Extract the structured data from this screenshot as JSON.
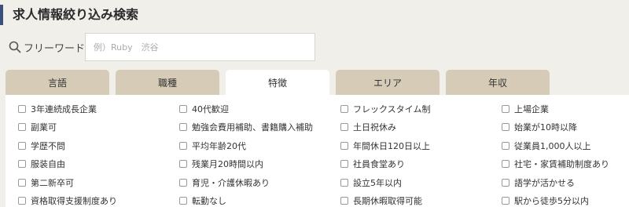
{
  "heading": "求人情報絞り込み検索",
  "search": {
    "label": "フリーワード",
    "placeholder": "例）Ruby　渋谷",
    "value": ""
  },
  "tabs": [
    {
      "label": "言語",
      "active": false
    },
    {
      "label": "職種",
      "active": false
    },
    {
      "label": "特徴",
      "active": true
    },
    {
      "label": "エリア",
      "active": false
    },
    {
      "label": "年収",
      "active": false
    }
  ],
  "options": [
    "3年連続成長企業",
    "40代歓迎",
    "フレックスタイム制",
    "上場企業",
    "副業可",
    "勉強会費用補助、書籍購入補助",
    "土日祝休み",
    "始業が10時以降",
    "学歴不問",
    "平均年齢20代",
    "年間休日120日以上",
    "従業員1,000人以上",
    "服装自由",
    "残業月20時間以内",
    "社員食堂あり",
    "社宅・家賃補助制度あり",
    "第二新卒可",
    "育児・介護休暇あり",
    "設立5年以内",
    "語学が活かせる",
    "資格取得支援制度あり",
    "転勤なし",
    "長期休暇取得可能",
    "駅から徒歩5分以内"
  ],
  "colors": {
    "heading_bar": "#3c4f7a",
    "tab_inactive": "#d6cbb6",
    "tab_active": "#ffffff",
    "page_bg": "#f1efea"
  }
}
